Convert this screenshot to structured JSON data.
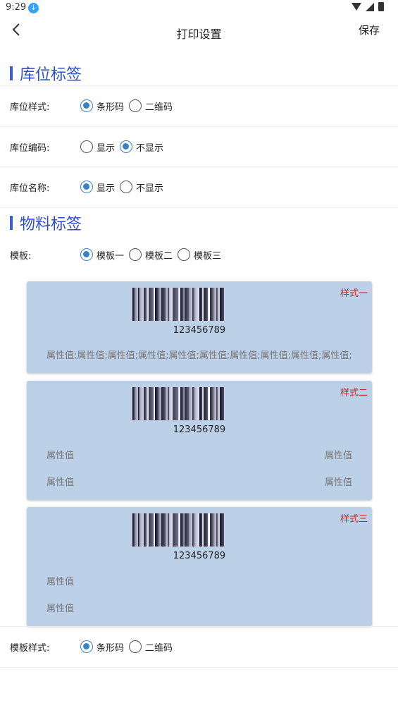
{
  "status": {
    "time": "9:29"
  },
  "header": {
    "title": "打印设置",
    "save_label": "保存"
  },
  "location_section": {
    "title": "库位标签",
    "rows": [
      {
        "label": "库位样式:",
        "options": [
          "条形码",
          "二维码"
        ],
        "selected": 0
      },
      {
        "label": "库位编码:",
        "options": [
          "显示",
          "不显示"
        ],
        "selected": 1
      },
      {
        "label": "库位名称:",
        "options": [
          "显示",
          "不显示"
        ],
        "selected": 0
      }
    ]
  },
  "material_section": {
    "title": "物料标签",
    "template_row": {
      "label": "模板:",
      "options": [
        "模板一",
        "模板二",
        "模板三"
      ],
      "selected": 0
    },
    "cards": [
      {
        "tag": "样式一",
        "number": "123456789",
        "attr_line": "属性值;属性值;属性值;属性值;属性值;属性值;属性值;属性值;属性值;属性值;"
      },
      {
        "tag": "样式二",
        "number": "123456789",
        "attr": "属性值"
      },
      {
        "tag": "样式三",
        "number": "123456789",
        "attr": "属性值"
      }
    ],
    "style_row": {
      "label": "模板样式:",
      "options": [
        "条形码",
        "二维码"
      ],
      "selected": 0
    }
  },
  "colors": {
    "accent": "#3b5fd9",
    "card_bg": "#bcd1e8",
    "tag": "#c82727",
    "radio": "#3b82c4"
  }
}
